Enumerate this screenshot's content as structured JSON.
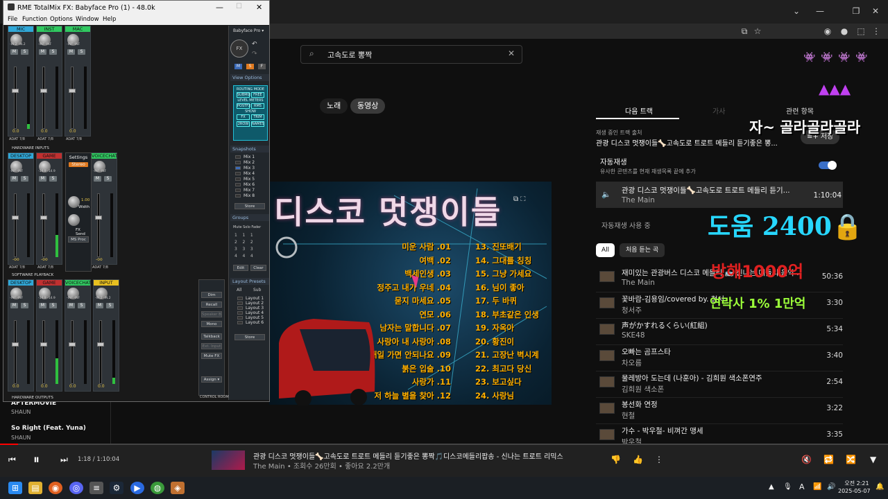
{
  "youtube": {
    "search": {
      "value": "고속도로 뽕짝"
    },
    "tab_songs": "노래",
    "tab_videos": "동영상",
    "panel_tabs": [
      "다음 트랙",
      "가사",
      "관련 항목"
    ],
    "now_playing_label": "재생 중인 트랙 출처",
    "now_playing_source": "관광 디스코 멋쟁이들🦴고속도로 트로트 메들리 듣기좋은 뽕...",
    "save_label": "≡+ 저장",
    "autoplay_title": "자동재생",
    "autoplay_sub": "유사한 콘텐츠를 현재 재생목록 끝에 추가",
    "current_track": {
      "title": "관광 디스코 멋쟁이들🦴고속도로 트로트 메들리 듣기...",
      "artist": "The Main",
      "duration": "1:10:04"
    },
    "autoplay_on_label": "자동재생 사용 중",
    "chips": [
      "All",
      "처음 듣는 곡"
    ],
    "queue": [
      {
        "title": "재미있는 관광버스 디스코 메들리 🚌 신나는 메들리 음악 ...",
        "artist": "The Main",
        "duration": "50:36"
      },
      {
        "title": "꽃바람-김용임/covered by. 청서",
        "artist": "청서주",
        "duration": "3:30"
      },
      {
        "title": "声がかすれるくらい(紅組)",
        "artist": "SKE48",
        "duration": "5:34"
      },
      {
        "title": "오빠는 곰프스타",
        "artist": "차오름",
        "duration": "3:40"
      },
      {
        "title": "물레방아 도는데 (나훈아) - 김희원 색소폰연주",
        "artist": "김희원 색소폰",
        "duration": "2:54"
      },
      {
        "title": "봉선화 연정",
        "artist": "현철",
        "duration": "3:22"
      },
      {
        "title": "가수 - 박우철- 비껴간 맹세",
        "artist": "박우철",
        "duration": "3:35"
      }
    ],
    "left_list": [
      {
        "title": "AFTERMOVIE",
        "artist": "SHAUN"
      },
      {
        "title": "So Right (Feat. Yuna)",
        "artist": "SHAUN"
      }
    ],
    "video": {
      "title": "디스코 멋쟁이들",
      "tracks_left": [
        "미운 사람 .01",
        "여백 .02",
        "백세인생 .03",
        "정주고 내가 우네 .04",
        "묻지 마세요 .05",
        "연모 .06",
        "남자는 말합니다 .07",
        "사랑아 내 사랑아 .08",
        "내일 가면 안되나요 .09",
        "붉은 입술 .10",
        "사랑가 .11",
        "저 하늘 별을 찾아 .12"
      ],
      "tracks_right": [
        "13. 진또배기",
        "14. 그대를 칭칭",
        "15. 그냥 가세요",
        "16. 님이 좋아",
        "17. 두 바퀴",
        "18. 부초같은 인생",
        "19. 자옥아",
        "20. 황진이",
        "21. 고장난 벽시계",
        "22. 최고다 당신",
        "23. 보고싶다",
        "24. 사랑님"
      ]
    },
    "player": {
      "time": "1:18 / 1:10:04",
      "title": "관광 디스코 멋쟁이들🦴고속도로 트로트 메들리 듣기좋은 뽕짝🎵디스코메들리팝송 - 신나는 트로트 리믹스",
      "subtitle": "The Main • 조회수 26만회 • 좋아요 2.2만개",
      "progress": 0.02
    }
  },
  "overlays": {
    "line1": "자~ 골라골라골라",
    "line2": "도움 2400🔒",
    "line3": "방해1000억",
    "line4": "연락사 1% 1만억"
  },
  "totalmix": {
    "title": "RME TotalMix FX: Babyface Pro (1) - 48.0k",
    "menu": [
      "File",
      "Function",
      "Options",
      "Window",
      "Help"
    ],
    "device": "Babyface Pro ▾",
    "hw_inputs_label": "HARDWARE INPUTS",
    "sw_playback_label": "SOFTWARE PLAYBACK",
    "hw_outputs_label": "HARDWARE OUTPUTS",
    "row1": [
      {
        "name": "MIC",
        "gain": "-IN.2 -IN.2",
        "val": "0.0",
        "foot": "ADAT 7/8",
        "level": 0.08
      },
      {
        "name": "INST",
        "gain": "-INF -INF",
        "val": "0.0",
        "foot": "ADAT 7/8",
        "level": 0
      },
      {
        "name": "MAC",
        "gain": "-INF -INF",
        "val": "0.0",
        "foot": "ADAT 7/8",
        "level": 0
      }
    ],
    "row2": [
      {
        "name": "DESKTOP",
        "gain": "-INF -INF",
        "val": "-oo",
        "foot": "ADAT 7/8",
        "level": 0
      },
      {
        "name": "GAME",
        "gain": "-14.9 -14.9",
        "val": "-oo",
        "foot": "ADAT 7/8",
        "level": 0.35
      },
      {
        "name": "VOICECHAT",
        "gain": "-INF -INF",
        "val": "-oo",
        "foot": "ADAT 7/8",
        "level": 0
      }
    ],
    "row3": [
      {
        "name": "DESKTOP",
        "gain": "-INF -INF",
        "val": "0.0",
        "level": 0
      },
      {
        "name": "GAME",
        "gain": "-14.9 -14.9",
        "val": "0.0",
        "level": 0.4
      },
      {
        "name": "VOICECHAT",
        "gain": "-INF -INF",
        "val": "0.0",
        "level": 0
      },
      {
        "name": "INPUT",
        "gain": "-IN.2 -IN.2",
        "val": "0.0",
        "level": 0.1
      }
    ],
    "settings": {
      "label": "Settings",
      "stereo": "Stereo",
      "width_val": "1.00",
      "width": "Width",
      "fxsend": "FX Send",
      "msproc": "MS Proc"
    },
    "view_options": "View Options",
    "routing": {
      "mode": "ROUTING MODE",
      "submix": "SUBMIX",
      "free": "FREE",
      "level": "LEVEL METERS",
      "post": "POSTFX",
      "rms": "RMS",
      "show": "SHOW",
      "fx": "FX",
      "trim": "TRIM",
      "twor": "2ROW",
      "names": "NAMES"
    },
    "snapshots": "Snapshots",
    "mixes": [
      "Mix 1",
      "Mix 2",
      "Mix 3",
      "Mix 4",
      "Mix 5",
      "Mix 6",
      "Mix 7",
      "Mix 8"
    ],
    "store": "Store",
    "groups": "Groups",
    "groups_cols": [
      "Mute",
      "Solo",
      "Fader"
    ],
    "edit": "Edit",
    "clear": "Clear",
    "layout_presets": "Layout Presets",
    "layout_tabs": [
      "All",
      "Sub"
    ],
    "layouts": [
      "Layout 1",
      "Layout 2",
      "Layout 3",
      "Layout 4",
      "Layout 5",
      "Layout 6"
    ],
    "control_buttons": [
      "Dim",
      "Recall",
      "Speaker B",
      "Mono",
      "Talkback",
      "Ext. Input",
      "Mute FX",
      "Assign ▾"
    ],
    "control_room": "CONTROL ROOM"
  },
  "clock": {
    "time": "오전 2:21",
    "date": "2025-05-07"
  }
}
